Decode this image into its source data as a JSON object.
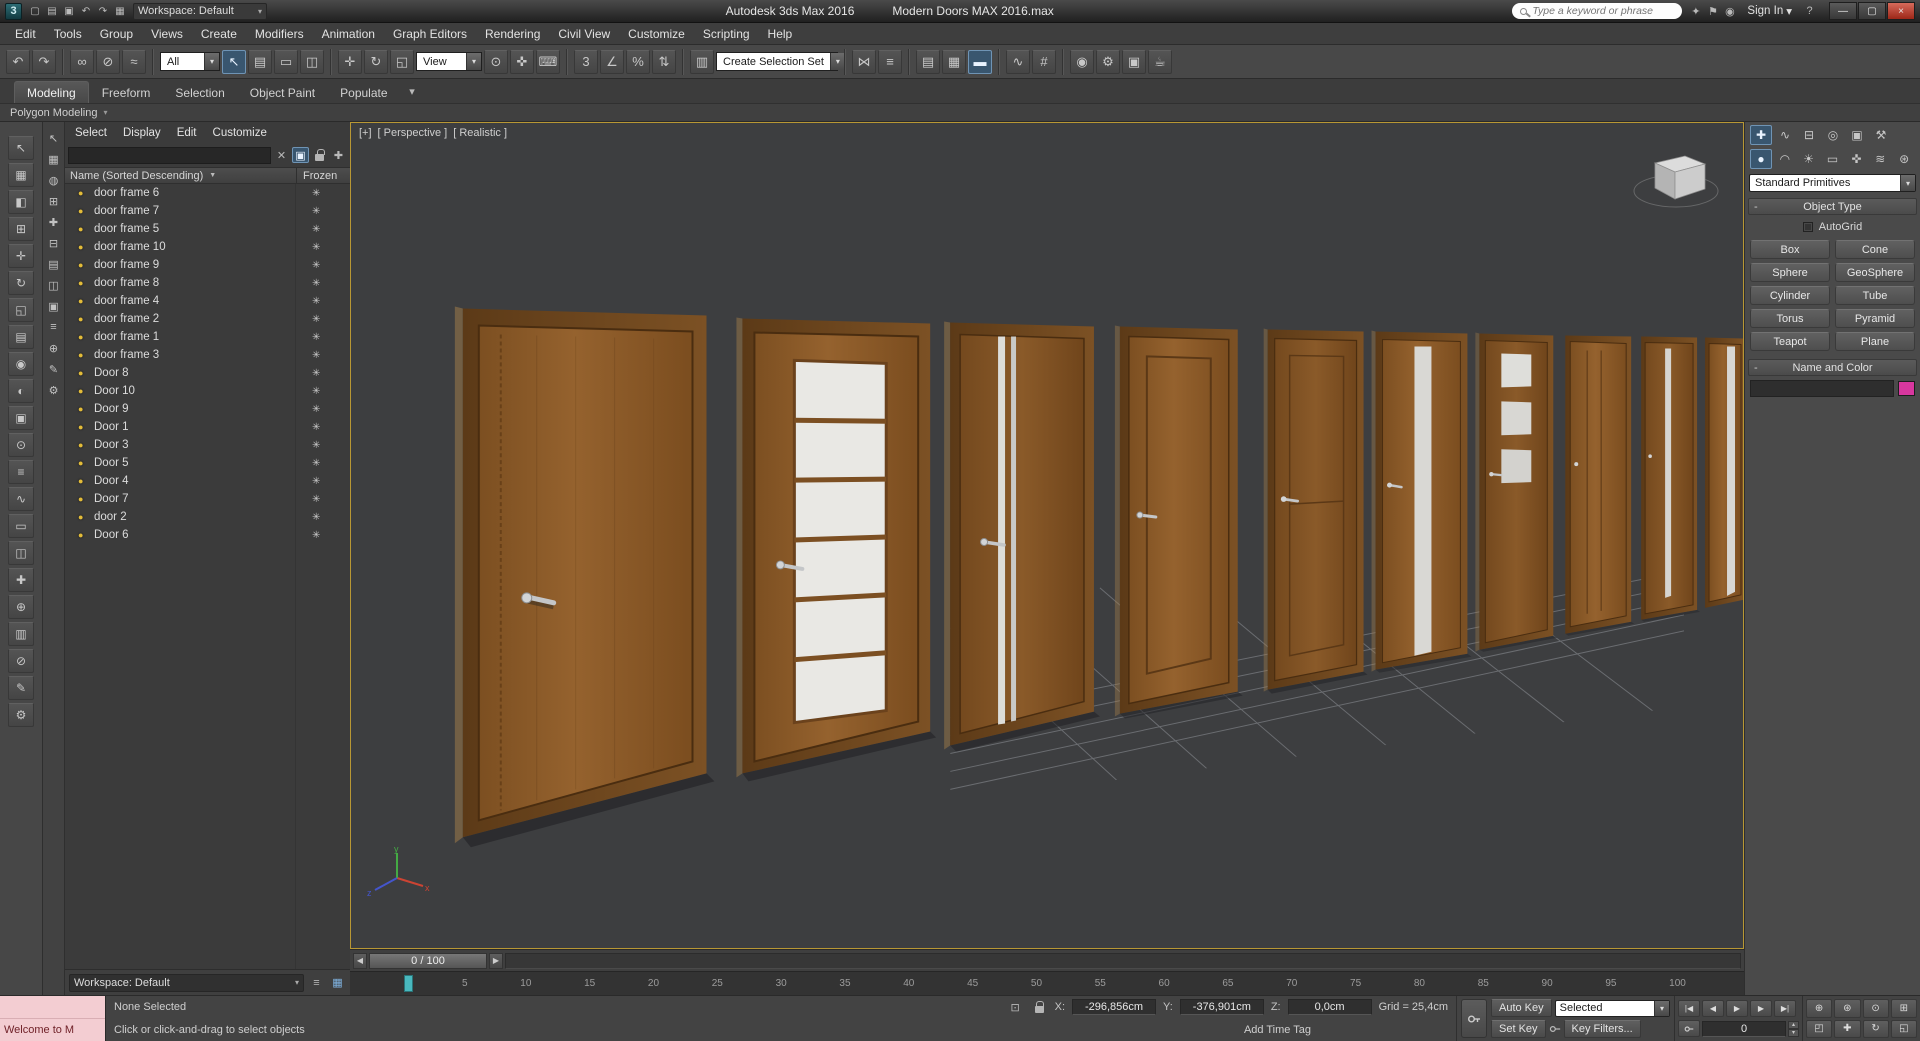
{
  "icons": {
    "dropdown": "▾",
    "dropdown_big": "▼",
    "minus": "-",
    "help": "?",
    "minimize": "—",
    "maximize": "▢",
    "close": "×",
    "bulb": "●",
    "snowflake": "✳",
    "clear": "✕",
    "plus": "✚",
    "sync": "▣",
    "layers": "≡",
    "grid_display": "▦",
    "isolate": "⊡",
    "slider_left": "◀",
    "slider_right": "▶",
    "spinner_up": "▴",
    "spinner_down": "▾"
  },
  "title_bar": {
    "logo_glyph": "3",
    "quick_access": [
      {
        "name": "new-scene-icon",
        "glyph": "▢"
      },
      {
        "name": "open-file-icon",
        "glyph": "▤"
      },
      {
        "name": "save-file-icon",
        "glyph": "▣"
      },
      {
        "name": "undo-quick-icon",
        "glyph": "↶"
      },
      {
        "name": "redo-quick-icon",
        "glyph": "↷"
      },
      {
        "name": "project-folder-icon",
        "glyph": "▦"
      }
    ],
    "workspace_label": "Workspace: Default",
    "app_title": "Autodesk 3ds Max 2016",
    "document_title": "Modern Doors MAX 2016.max",
    "search_placeholder": "Type a keyword or phrase",
    "right_icons": [
      {
        "name": "infocenter-star-icon",
        "glyph": "✦"
      },
      {
        "name": "notifications-icon",
        "glyph": "⚑"
      },
      {
        "name": "user-icon",
        "glyph": "◉"
      }
    ],
    "sign_in": "Sign In"
  },
  "menu_bar": [
    "Edit",
    "Tools",
    "Group",
    "Views",
    "Create",
    "Modifiers",
    "Animation",
    "Graph Editors",
    "Rendering",
    "Civil View",
    "Customize",
    "Scripting",
    "Help"
  ],
  "toolbar": {
    "filter_dropdown": "All",
    "refcoord_dropdown": "View",
    "selset_dropdown": "Create Selection Set",
    "g1": [
      {
        "name": "undo-icon",
        "glyph": "↶"
      },
      {
        "name": "redo-icon",
        "glyph": "↷"
      }
    ],
    "g2": [
      {
        "name": "select-and-link-icon",
        "glyph": "∞"
      },
      {
        "name": "unlink-selection-icon",
        "glyph": "⊘"
      },
      {
        "name": "bind-to-space-warp-icon",
        "glyph": "≈"
      }
    ],
    "g3": [
      {
        "name": "select-object-tool",
        "glyph": "↖"
      },
      {
        "name": "select-by-name-icon",
        "glyph": "▤"
      }
    ],
    "g4": [
      {
        "name": "rectangular-selection-icon",
        "glyph": "▭"
      },
      {
        "name": "window-crossing-icon",
        "glyph": "◫"
      }
    ],
    "g5": [
      {
        "name": "select-and-move-icon",
        "glyph": "✛"
      },
      {
        "name": "select-and-rotate-icon",
        "glyph": "↻"
      },
      {
        "name": "select-and-scale-icon",
        "glyph": "◱"
      }
    ],
    "g6": [
      {
        "name": "use-pivot-center-icon",
        "glyph": "⊙"
      },
      {
        "name": "select-and-manipulate-icon",
        "glyph": "✜"
      },
      {
        "name": "keyboard-override-icon",
        "glyph": "⌨"
      }
    ],
    "g7": [
      {
        "name": "snaps-toggle-icon",
        "glyph": "3"
      },
      {
        "name": "angle-snap-icon",
        "glyph": "∠"
      },
      {
        "name": "percent-snap-icon",
        "glyph": "%"
      },
      {
        "name": "spinner-snap-icon",
        "glyph": "⇅"
      }
    ],
    "g8": [
      {
        "name": "named-selection-sets-icon",
        "glyph": "▥"
      }
    ],
    "g9": [
      {
        "name": "mirror-icon",
        "glyph": "⋈"
      },
      {
        "name": "align-icon",
        "glyph": "≡"
      }
    ],
    "g10": [
      {
        "name": "scene-explorer-toggle-icon",
        "glyph": "▤"
      },
      {
        "name": "layer-explorer-icon",
        "glyph": "▦"
      },
      {
        "name": "toggle-ribbon-tool",
        "glyph": "▬"
      }
    ],
    "g11": [
      {
        "name": "curve-editor-icon",
        "glyph": "∿"
      },
      {
        "name": "schematic-view-icon",
        "glyph": "#"
      }
    ],
    "g12": [
      {
        "name": "material-editor-icon",
        "glyph": "◉"
      },
      {
        "name": "render-setup-icon",
        "glyph": "⚙"
      },
      {
        "name": "rendered-frame-icon",
        "glyph": "▣"
      },
      {
        "name": "render-production-icon",
        "glyph": "☕"
      }
    ]
  },
  "ribbon": {
    "tabs": [
      {
        "name": "tab-modeling",
        "label": "Modeling"
      },
      {
        "name": "tab-freeform",
        "label": "Freeform"
      },
      {
        "name": "tab-selection",
        "label": "Selection"
      },
      {
        "name": "tab-object-paint",
        "label": "Object Paint"
      },
      {
        "name": "tab-populate",
        "label": "Populate"
      }
    ],
    "panel_strip": "Polygon Modeling"
  },
  "left_dock": [
    {
      "name": "dock-tool-1",
      "glyph": "↖"
    },
    {
      "name": "dock-tool-2",
      "glyph": "▦"
    },
    {
      "name": "dock-tool-3",
      "glyph": "◧"
    },
    {
      "name": "dock-tool-4",
      "glyph": "⊞"
    },
    {
      "name": "dock-tool-5",
      "glyph": "✛"
    },
    {
      "name": "dock-tool-6",
      "glyph": "↻"
    },
    {
      "name": "dock-tool-7",
      "glyph": "◱"
    },
    {
      "name": "dock-tool-8",
      "glyph": "▤"
    },
    {
      "name": "dock-tool-9",
      "glyph": "◉"
    },
    {
      "name": "dock-tool-10",
      "glyph": "◐"
    },
    {
      "name": "dock-tool-11",
      "glyph": "▣"
    },
    {
      "name": "dock-tool-12",
      "glyph": "⊙"
    },
    {
      "name": "dock-tool-13",
      "glyph": "≡"
    },
    {
      "name": "dock-tool-14",
      "glyph": "∿"
    },
    {
      "name": "dock-tool-15",
      "glyph": "▭"
    },
    {
      "name": "dock-tool-16",
      "glyph": "◫"
    },
    {
      "name": "dock-tool-17",
      "glyph": "✚"
    },
    {
      "name": "dock-tool-18",
      "glyph": "⊕"
    },
    {
      "name": "dock-tool-19",
      "glyph": "▥"
    },
    {
      "name": "dock-tool-20",
      "glyph": "⊘"
    },
    {
      "name": "dock-tool-21",
      "glyph": "✎"
    },
    {
      "name": "dock-tool-22",
      "glyph": "⚙"
    }
  ],
  "scene_explorer": {
    "strip": [
      {
        "name": "explorer-tool-1",
        "glyph": "↖"
      },
      {
        "name": "explorer-tool-2",
        "glyph": "▦"
      },
      {
        "name": "explorer-tool-3",
        "glyph": "◍"
      },
      {
        "name": "explorer-tool-4",
        "glyph": "⊞"
      },
      {
        "name": "explorer-tool-5",
        "glyph": "✚"
      },
      {
        "name": "explorer-tool-6",
        "glyph": "⊟"
      },
      {
        "name": "explorer-tool-7",
        "glyph": "▤"
      },
      {
        "name": "explorer-tool-8",
        "glyph": "◫"
      },
      {
        "name": "explorer-tool-9",
        "glyph": "▣"
      },
      {
        "name": "explorer-tool-10",
        "glyph": "≡"
      },
      {
        "name": "explorer-tool-11",
        "glyph": "⊕"
      },
      {
        "name": "explorer-tool-12",
        "glyph": "✎"
      },
      {
        "name": "explorer-tool-13",
        "glyph": "⚙"
      }
    ],
    "menus": [
      "Select",
      "Display",
      "Edit",
      "Customize"
    ],
    "name_column": "Name (Sorted Descending)",
    "frozen_column": "Frozen",
    "items": [
      "door frame 6",
      "door frame 7",
      "door frame 5",
      "door frame 10",
      "door frame 9",
      "door frame 8",
      "door frame 4",
      "door frame 2",
      "door frame 1",
      "door frame 3",
      "Door 8",
      "Door 10",
      "Door 9",
      "Door 1",
      "Door 3",
      "Door 5",
      "Door 4",
      "Door 7",
      "door 2",
      "Door 6"
    ],
    "workspace_label": "Workspace: Default"
  },
  "viewport": {
    "label_plus": "[+]",
    "label_view": "[ Perspective ]",
    "label_shading": "[ Realistic ]"
  },
  "timeline": {
    "slider_label": "0 / 100",
    "ticks": [
      "5",
      "10",
      "15",
      "20",
      "25",
      "30",
      "35",
      "40",
      "45",
      "50",
      "55",
      "60",
      "65",
      "70",
      "75",
      "80",
      "85",
      "90",
      "95",
      "100"
    ]
  },
  "command_panel": {
    "tabs": [
      {
        "name": "panel-tab-create",
        "glyph": "✚"
      },
      {
        "name": "panel-tab-modify",
        "glyph": "∿"
      },
      {
        "name": "panel-tab-hierarchy",
        "glyph": "⊟"
      },
      {
        "name": "panel-tab-motion",
        "glyph": "◎"
      },
      {
        "name": "panel-tab-display",
        "glyph": "▣"
      },
      {
        "name": "panel-tab-utilities",
        "glyph": "⚒"
      }
    ],
    "categories": [
      {
        "name": "cat-geometry",
        "glyph": "●"
      },
      {
        "name": "cat-shapes",
        "glyph": "◠"
      },
      {
        "name": "cat-lights",
        "glyph": "☀"
      },
      {
        "name": "cat-cameras",
        "glyph": "▭"
      },
      {
        "name": "cat-helpers",
        "glyph": "✜"
      },
      {
        "name": "cat-spacewarps",
        "glyph": "≋"
      },
      {
        "name": "cat-systems",
        "glyph": "⊛"
      }
    ],
    "object_class_dropdown": "Standard Primitives",
    "object_type": {
      "title": "Object Type",
      "autogrid_label": "AutoGrid",
      "buttons": [
        {
          "name": "box-button",
          "label": "Box"
        },
        {
          "name": "cone-button",
          "label": "Cone"
        },
        {
          "name": "sphere-button",
          "label": "Sphere"
        },
        {
          "name": "geosphere-button",
          "label": "GeoSphere"
        },
        {
          "name": "cylinder-button",
          "label": "Cylinder"
        },
        {
          "name": "tube-button",
          "label": "Tube"
        },
        {
          "name": "torus-button",
          "label": "Torus"
        },
        {
          "name": "pyramid-button",
          "label": "Pyramid"
        },
        {
          "name": "teapot-button",
          "label": "Teapot"
        },
        {
          "name": "plane-button",
          "label": "Plane"
        }
      ]
    },
    "name_color_title": "Name and Color",
    "name_color_swatch_style": "background:#D8379F"
  },
  "status_bar": {
    "listener_text": "Welcome to M",
    "selection_status": "None Selected",
    "prompt": "Click or click-and-drag to select objects",
    "x_label": "X:",
    "y_label": "Y:",
    "z_label": "Z:",
    "x_value": "-296,856cm",
    "y_value": "-376,901cm",
    "z_value": "0,0cm",
    "grid_text": "Grid = 25,4cm",
    "add_time_tag": "Add Time Tag",
    "auto_key": "Auto Key",
    "set_key": "Set Key",
    "selected_dropdown": "Selected",
    "key_filters": "Key Filters...",
    "frame_value": "0",
    "transport": [
      {
        "name": "go-start-button",
        "glyph": "|◀"
      },
      {
        "name": "prev-frame-button",
        "glyph": "◀"
      },
      {
        "name": "play-button",
        "glyph": "▶"
      },
      {
        "name": "next-frame-button",
        "glyph": "▶"
      },
      {
        "name": "go-end-button",
        "glyph": "▶|"
      }
    ],
    "nav_icons": [
      {
        "name": "zoom-icon",
        "glyph": "⊕"
      },
      {
        "name": "zoom-all-icon",
        "glyph": "⊛"
      },
      {
        "name": "zoom-extents-icon",
        "glyph": "⊙"
      },
      {
        "name": "zoom-extents-all-icon",
        "glyph": "⊞"
      },
      {
        "name": "zoom-region-icon",
        "glyph": "◰"
      },
      {
        "name": "pan-icon",
        "glyph": "✚"
      },
      {
        "name": "orbit-icon",
        "glyph": "↻"
      },
      {
        "name": "maximize-viewport-icon",
        "glyph": "◱"
      }
    ]
  },
  "ui_state": {
    "active": [
      "select-object-tool",
      "toggle-ribbon-tool",
      "tab-modeling",
      "cat-geometry",
      "panel-tab-create",
      "explorer-sync-icon"
    ]
  }
}
